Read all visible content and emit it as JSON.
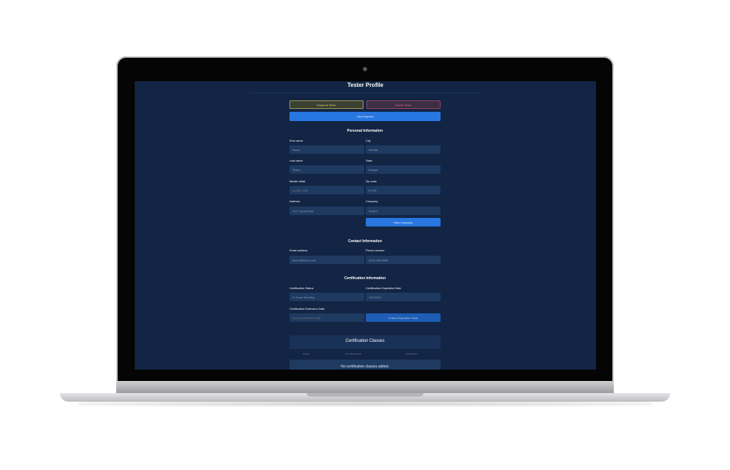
{
  "page": {
    "title": "Tester Profile"
  },
  "actions": {
    "suspend_label": "Suspend Tester",
    "delete_label": "Delete Tester",
    "reports_label": "View Reports",
    "view_company_label": "View Company",
    "extend_label": "Extend Expiration Date"
  },
  "personal": {
    "heading": "Personal Information",
    "first_name": {
      "label": "First name",
      "value": "Shree"
    },
    "last_name": {
      "label": "Last name",
      "value": "Tester"
    },
    "middle_initial": {
      "label": "Middle initial",
      "placeholder": "middle initial"
    },
    "address": {
      "label": "Address",
      "value": "4417 Sprat Drive"
    },
    "city": {
      "label": "City",
      "value": "Wichita"
    },
    "state": {
      "label": "State",
      "value": "Kansas"
    },
    "zip": {
      "label": "Zip code",
      "value": "67230"
    },
    "company": {
      "label": "Company",
      "value": "TestKO"
    }
  },
  "contact": {
    "heading": "Contact Information",
    "email": {
      "label": "Email address",
      "value": "tester@testco.com"
    },
    "phone": {
      "label": "Phone number",
      "value": "(314) 435-4856"
    }
  },
  "certification": {
    "heading": "Certification Information",
    "status": {
      "label": "Certification Status",
      "value": "In Good Standing"
    },
    "expiration": {
      "label": "Certification Expiration Date",
      "value": "1/31/2022"
    },
    "extension": {
      "label": "Certification Extension Date",
      "placeholder": "choose extension date"
    }
  },
  "classes": {
    "title": "Certification Classes",
    "columns": [
      "DATE",
      "INSTRUCTOR",
      "COMPANY"
    ],
    "empty": "No certification classes added."
  },
  "colors": {
    "screen_bg": "#122544",
    "field_bg": "#1f3a61",
    "accent": "#2877e0",
    "warning": "#d8c870",
    "danger": "#d66a8a"
  }
}
